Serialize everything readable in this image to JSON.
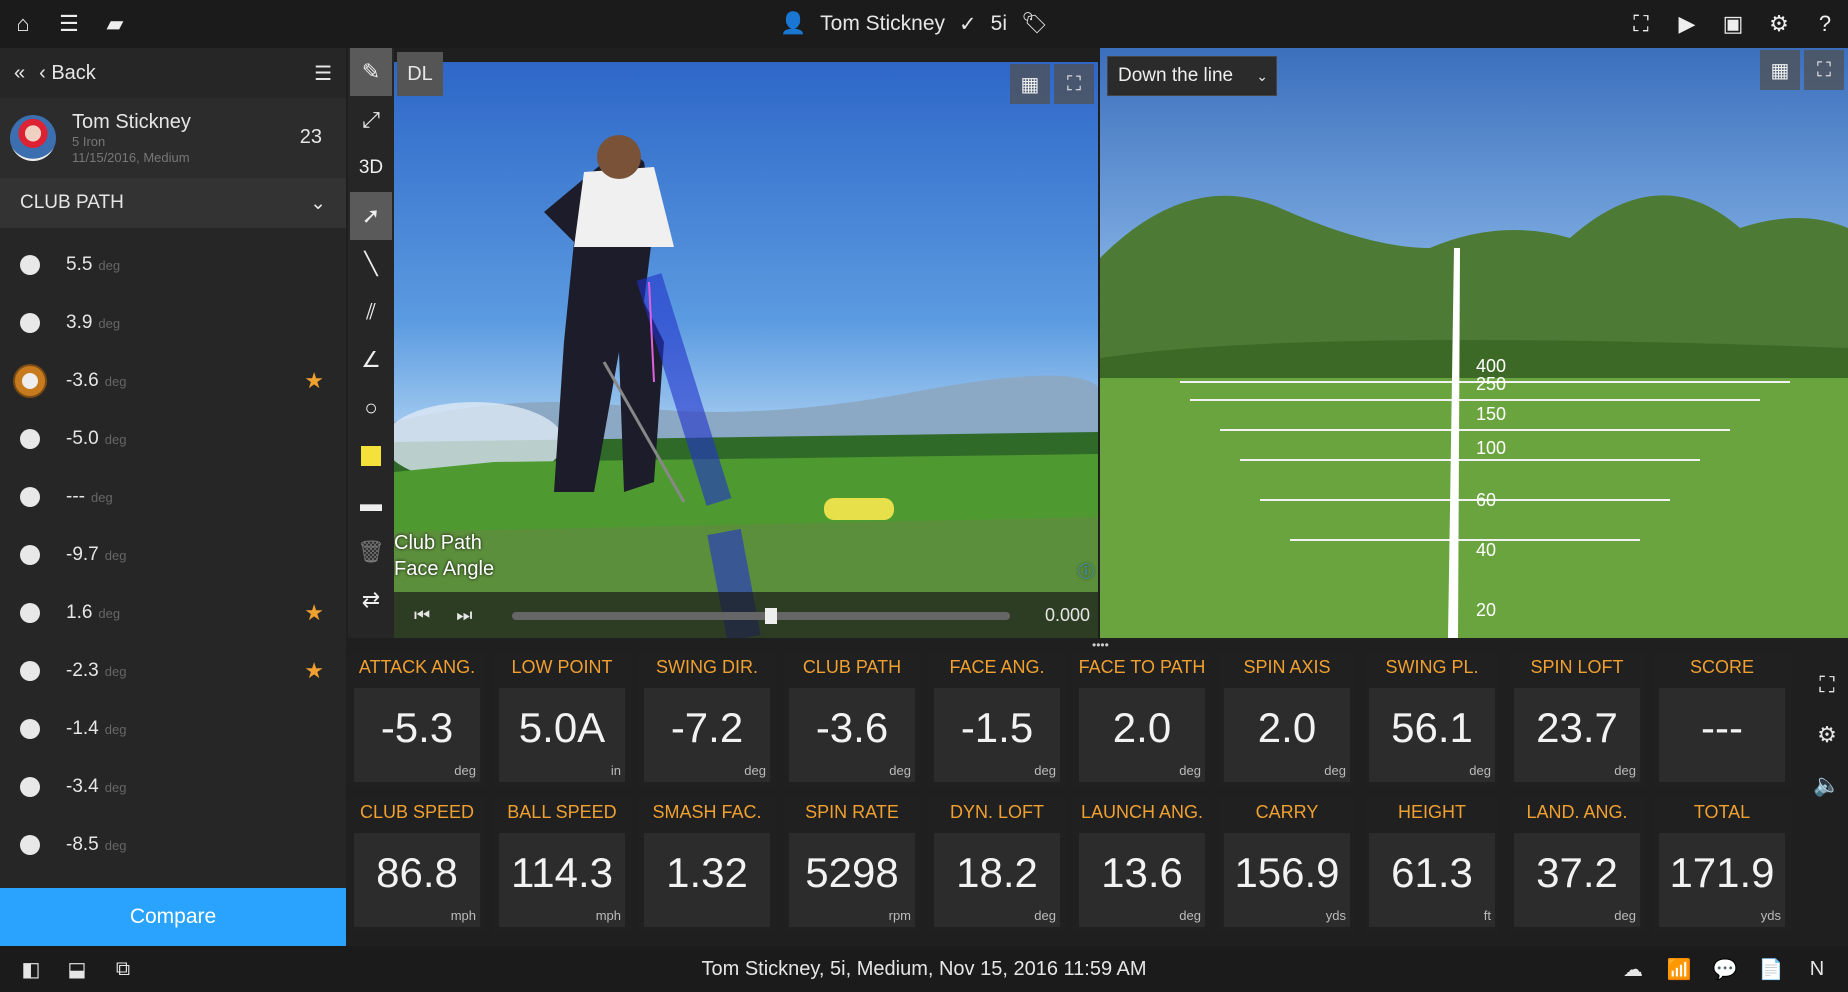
{
  "header": {
    "user": "Tom Stickney",
    "club": "5i"
  },
  "sidebar": {
    "back": "Back",
    "player": "Tom Stickney",
    "club": "5 Iron",
    "meta": "11/15/2016, Medium",
    "count": "23",
    "section": "CLUB PATH",
    "shots": [
      {
        "v": "5.5",
        "u": "deg",
        "star": false,
        "sel": false
      },
      {
        "v": "3.9",
        "u": "deg",
        "star": false,
        "sel": false
      },
      {
        "v": "-3.6",
        "u": "deg",
        "star": true,
        "sel": true
      },
      {
        "v": "-5.0",
        "u": "deg",
        "star": false,
        "sel": false
      },
      {
        "v": "---",
        "u": "deg",
        "star": false,
        "sel": false
      },
      {
        "v": "-9.7",
        "u": "deg",
        "star": false,
        "sel": false
      },
      {
        "v": "1.6",
        "u": "deg",
        "star": true,
        "sel": false
      },
      {
        "v": "-2.3",
        "u": "deg",
        "star": true,
        "sel": false
      },
      {
        "v": "-1.4",
        "u": "deg",
        "star": false,
        "sel": false
      },
      {
        "v": "-3.4",
        "u": "deg",
        "star": false,
        "sel": false
      },
      {
        "v": "-8.5",
        "u": "deg",
        "star": false,
        "sel": false
      }
    ],
    "compare": "Compare"
  },
  "tools": {
    "dl": "DL",
    "threeD": "3D"
  },
  "video": {
    "overlay1": "Club Path",
    "overlay2": "Face Angle",
    "time": "0.000",
    "progress": 0.52
  },
  "view3d": {
    "view": "Down the line",
    "distances": [
      "400",
      "250",
      "150",
      "100",
      "60",
      "40",
      "20"
    ]
  },
  "metrics": [
    {
      "label": "ATTACK ANG.",
      "value": "-5.3",
      "unit": "deg"
    },
    {
      "label": "LOW POINT",
      "value": "5.0A",
      "unit": "in"
    },
    {
      "label": "SWING DIR.",
      "value": "-7.2",
      "unit": "deg"
    },
    {
      "label": "CLUB PATH",
      "value": "-3.6",
      "unit": "deg"
    },
    {
      "label": "FACE ANG.",
      "value": "-1.5",
      "unit": "deg"
    },
    {
      "label": "FACE TO PATH",
      "value": "2.0",
      "unit": "deg"
    },
    {
      "label": "SPIN AXIS",
      "value": "2.0",
      "unit": "deg"
    },
    {
      "label": "SWING PL.",
      "value": "56.1",
      "unit": "deg"
    },
    {
      "label": "SPIN LOFT",
      "value": "23.7",
      "unit": "deg"
    },
    {
      "label": "SCORE",
      "value": "---",
      "unit": ""
    },
    {
      "label": "CLUB SPEED",
      "value": "86.8",
      "unit": "mph"
    },
    {
      "label": "BALL SPEED",
      "value": "114.3",
      "unit": "mph"
    },
    {
      "label": "SMASH FAC.",
      "value": "1.32",
      "unit": ""
    },
    {
      "label": "SPIN RATE",
      "value": "5298",
      "unit": "rpm"
    },
    {
      "label": "DYN. LOFT",
      "value": "18.2",
      "unit": "deg"
    },
    {
      "label": "LAUNCH ANG.",
      "value": "13.6",
      "unit": "deg"
    },
    {
      "label": "CARRY",
      "value": "156.9",
      "unit": "yds"
    },
    {
      "label": "HEIGHT",
      "value": "61.3",
      "unit": "ft"
    },
    {
      "label": "LAND. ANG.",
      "value": "37.2",
      "unit": "deg"
    },
    {
      "label": "TOTAL",
      "value": "171.9",
      "unit": "yds"
    }
  ],
  "status": "Tom Stickney, 5i, Medium, Nov 15, 2016 11:59 AM",
  "colors": {
    "accent": "#f0a030",
    "compare": "#2aa3ff",
    "selected": "#c87a1e"
  }
}
